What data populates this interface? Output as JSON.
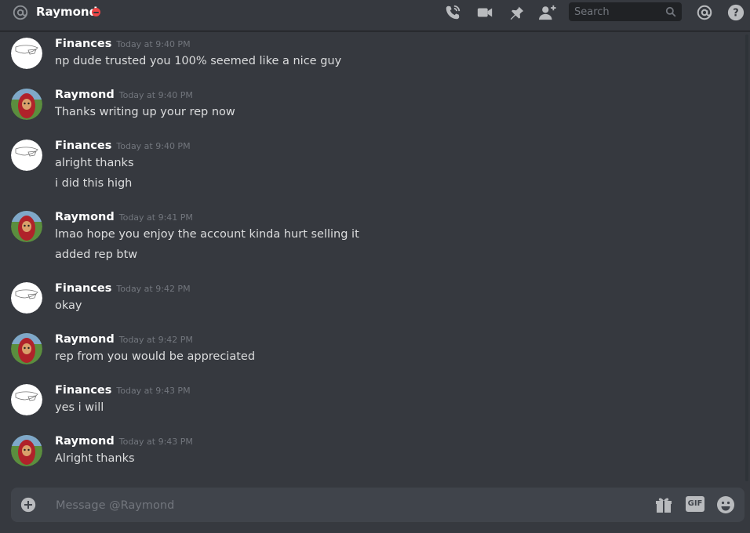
{
  "header": {
    "title": "Raymond",
    "status": "Do Not Disturb",
    "icons": [
      "at-icon",
      "call-icon",
      "video-icon",
      "pin-icon",
      "add-member-icon",
      "mention-icon",
      "help-icon"
    ],
    "search_placeholder": "Search"
  },
  "messages": [
    {
      "author": "Finances",
      "time": "Today at 9:40 PM",
      "avatar": "finances-avatar",
      "lines": [
        "np dude trusted you 100% seemed like a nice guy"
      ]
    },
    {
      "author": "Raymond",
      "time": "Today at 9:40 PM",
      "avatar": "raymond-avatar",
      "lines": [
        "Thanks writing up your rep now"
      ]
    },
    {
      "author": "Finances",
      "time": "Today at 9:40 PM",
      "avatar": "finances-avatar",
      "lines": [
        "alright thanks",
        "i did this high"
      ]
    },
    {
      "author": "Raymond",
      "time": "Today at 9:41 PM",
      "avatar": "raymond-avatar",
      "lines": [
        "lmao hope you enjoy the account kinda hurt selling it",
        "added rep btw"
      ]
    },
    {
      "author": "Finances",
      "time": "Today at 9:42 PM",
      "avatar": "finances-avatar",
      "lines": [
        "okay"
      ]
    },
    {
      "author": "Raymond",
      "time": "Today at 9:42 PM",
      "avatar": "raymond-avatar",
      "lines": [
        "rep from you would be appreciated"
      ]
    },
    {
      "author": "Finances",
      "time": "Today at 9:43 PM",
      "avatar": "finances-avatar",
      "lines": [
        "yes i will"
      ]
    },
    {
      "author": "Raymond",
      "time": "Today at 9:43 PM",
      "avatar": "raymond-avatar",
      "lines": [
        "Alright thanks"
      ]
    }
  ],
  "composer": {
    "placeholder": "Message @Raymond",
    "gif_label": "GIF",
    "icons": [
      "plus-icon",
      "gift-icon",
      "gif-icon",
      "emoji-icon"
    ]
  },
  "colors": {
    "background": "#36393f",
    "composer": "#40444b",
    "search": "#202225",
    "dnd": "#f04747",
    "username": "#ffffff",
    "text": "#dcddde",
    "timestamp": "#72767d"
  }
}
